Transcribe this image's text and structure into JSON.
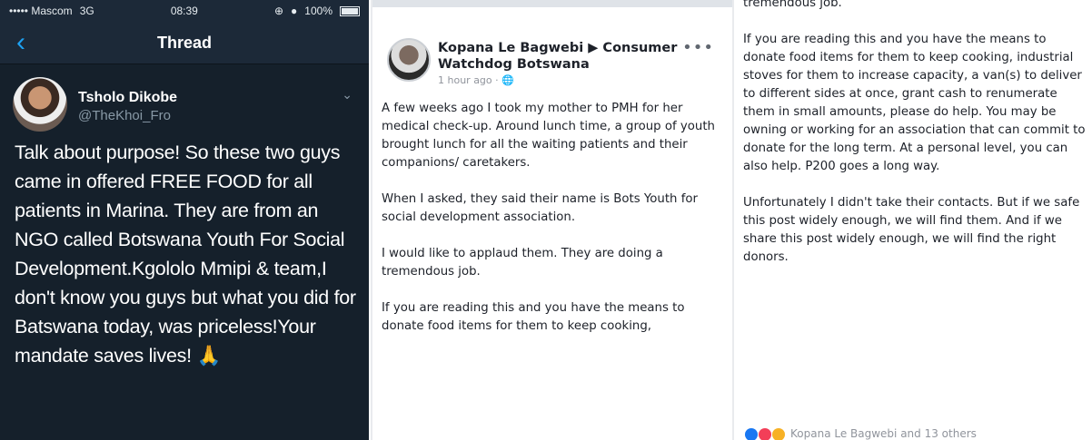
{
  "colors": {
    "twitter_bg": "#15202b",
    "twitter_blue": "#1da1f2",
    "fb_text": "#1d2129",
    "fb_meta": "#90949c"
  },
  "status_bar": {
    "carrier": "••••• Mascom",
    "network": "3G",
    "time": "08:39",
    "battery": "100%"
  },
  "thread": {
    "title": "Thread",
    "back_icon": "chevron-left-icon",
    "author_name": "Tsholo Dikobe",
    "author_handle": "@TheKhoi_Fro",
    "text": "Talk about purpose! So these two guys came in offered FREE FOOD for all patients in Marina. They are from an NGO called Botswana Youth For Social Development.Kgololo Mmipi & team,I don't know you guys but what you did for Batswana today, was priceless!Your mandate saves lives! 🙏"
  },
  "fb_post": {
    "author": "Kopana Le Bagwebi ▶ Consumer Watchdog Botswana",
    "meta": "1 hour ago · 🌐",
    "paragraphs": [
      "A few weeks ago I took my mother to PMH for her medical check-up. Around lunch time, a group of youth brought lunch for all the waiting patients and their companions/ caretakers.",
      "When I asked, they said their name is Bots Youth for social development association.",
      "I would like to applaud them. They are doing a tremendous job.",
      "If you are reading this and you have the means to donate food items for them to keep cooking,"
    ]
  },
  "fb_post_cont": {
    "paragraphs": [
      "tremendous job.",
      "If you are reading this and you have the means to donate food items for them to keep cooking, industrial stoves for them to increase capacity, a van(s) to deliver to different sides at once, grant cash to renumerate them in small amounts, please do help. You may be owning or working for an association that can commit to donate for the long term. At a personal level, you can also help. P200 goes a long way.",
      "Unfortunately I didn't take their contacts. But if we safe this post widely enough, we will find them. And if we share this post widely enough, we will find the right donors."
    ],
    "reactions_text": "Kopana Le Bagwebi and 13 others"
  }
}
